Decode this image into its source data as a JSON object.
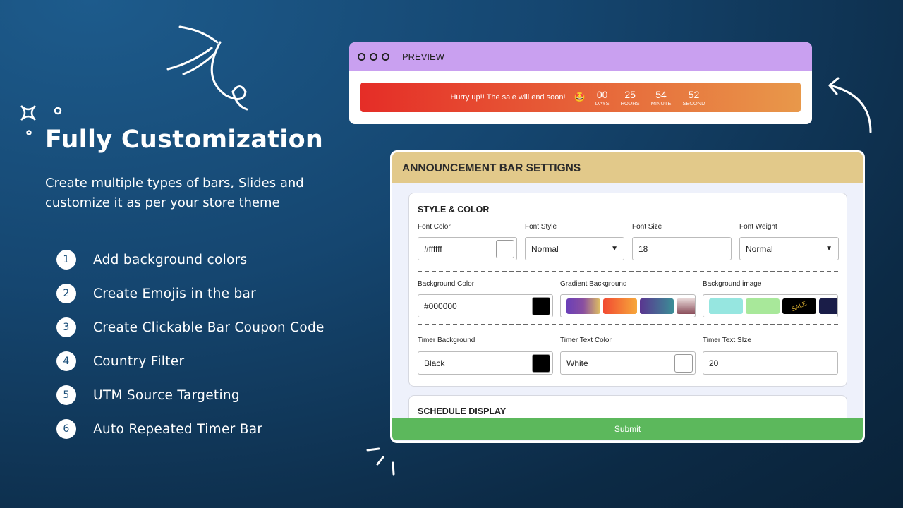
{
  "left": {
    "title": "Fully Customization",
    "subtitle": "Create multiple types of bars, Slides and customize it as per your store theme",
    "features": [
      {
        "n": "1",
        "label": "Add background colors"
      },
      {
        "n": "2",
        "label": "Create Emojis in the bar"
      },
      {
        "n": "3",
        "label": "Create Clickable Bar Coupon Code"
      },
      {
        "n": "4",
        "label": "Country Filter"
      },
      {
        "n": "5",
        "label": "UTM Source Targeting"
      },
      {
        "n": "6",
        "label": "Auto Repeated Timer Bar"
      }
    ]
  },
  "preview": {
    "title": "PREVIEW",
    "message": "Hurry up!! The sale will end soon!",
    "emoji": "🤩",
    "timer": [
      {
        "v": "00",
        "u": "DAYS"
      },
      {
        "v": "25",
        "u": "HOURS"
      },
      {
        "v": "54",
        "u": "MINUTE"
      },
      {
        "v": "52",
        "u": "SECOND"
      }
    ]
  },
  "settings": {
    "title": "ANNOUNCEMENT BAR SETTIGNS",
    "section1": "STYLE & COLOR",
    "font_color_label": "Font Color",
    "font_color": "#ffffff",
    "font_style_label": "Font Style",
    "font_style": "Normal",
    "font_size_label": "Font Size",
    "font_size": "18",
    "font_weight_label": "Font Weight",
    "font_weight": "Normal",
    "bg_color_label": "Background Color",
    "bg_color": "#000000",
    "gradient_label": "Gradient Background",
    "bg_image_label": "Background image",
    "sale_text": "SALE",
    "timer_bg_label": "Timer Background",
    "timer_bg": "Black",
    "timer_text_color_label": "Timer Text Color",
    "timer_text_color": "White",
    "timer_text_size_label": "Timer Text SIze",
    "timer_text_size": "20",
    "section2": "SCHEDULE DISPLAY",
    "submit": "Submit"
  }
}
